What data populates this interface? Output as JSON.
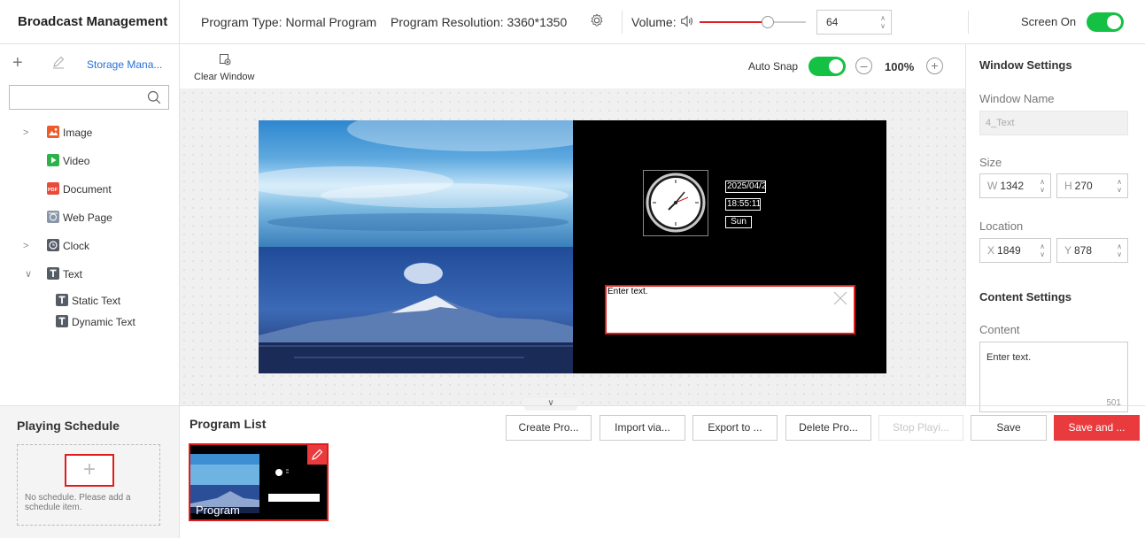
{
  "header": {
    "title": "Broadcast Management",
    "program_type": "Program Type: Normal Program",
    "program_resolution": "Program Resolution: 3360*1350",
    "volume_label": "Volume:",
    "volume_value": "64",
    "volume_level": 0.64,
    "screen_label": "Screen On",
    "screen_on": true
  },
  "sidebar": {
    "storage_link": "Storage Mana...",
    "search_placeholder": "",
    "items": [
      {
        "label": "Image",
        "icon": "image-icon",
        "expandable": true
      },
      {
        "label": "Video",
        "icon": "video-icon"
      },
      {
        "label": "Document",
        "icon": "pdf-icon"
      },
      {
        "label": "Web Page",
        "icon": "webpage-icon"
      },
      {
        "label": "Clock",
        "icon": "clock-icon",
        "expandable": true
      },
      {
        "label": "Text",
        "icon": "text-icon",
        "expanded": true
      },
      {
        "label": "Static Text",
        "icon": "text-icon",
        "child": true
      },
      {
        "label": "Dynamic Text",
        "icon": "text-icon",
        "child": true
      }
    ]
  },
  "canvas_toolbar": {
    "clear_window": "Clear Window",
    "auto_snap": "Auto Snap",
    "auto_snap_on": true,
    "zoom": "100%"
  },
  "canvas": {
    "clock_date": "2025/04/2",
    "clock_time": "18:55:11",
    "clock_day": "Sun",
    "text_window": "Enter text."
  },
  "window_settings": {
    "heading": "Window Settings",
    "name_label": "Window Name",
    "name_value": "4_Text",
    "size_label": "Size",
    "width_prefix": "W",
    "width_value": "1342",
    "height_prefix": "H",
    "height_value": "270",
    "location_label": "Location",
    "x_prefix": "X",
    "x_value": "1849",
    "y_prefix": "Y",
    "y_value": "878",
    "content_heading": "Content Settings",
    "content_label": "Content",
    "content_value": "Enter text.",
    "content_counter": "501"
  },
  "schedule": {
    "heading": "Playing Schedule",
    "empty_message": "No schedule. Please add a schedule item."
  },
  "program_list": {
    "heading": "Program List",
    "buttons": {
      "create": "Create Pro...",
      "import": "Import via...",
      "export": "Export to ...",
      "delete": "Delete Pro...",
      "stop": "Stop Playi...",
      "save": "Save",
      "save_and": "Save and ..."
    },
    "program_name": "Program"
  },
  "colors": {
    "accent_red": "#e93b3e",
    "toggle_green": "#15c144",
    "link_blue": "#2770d6"
  }
}
